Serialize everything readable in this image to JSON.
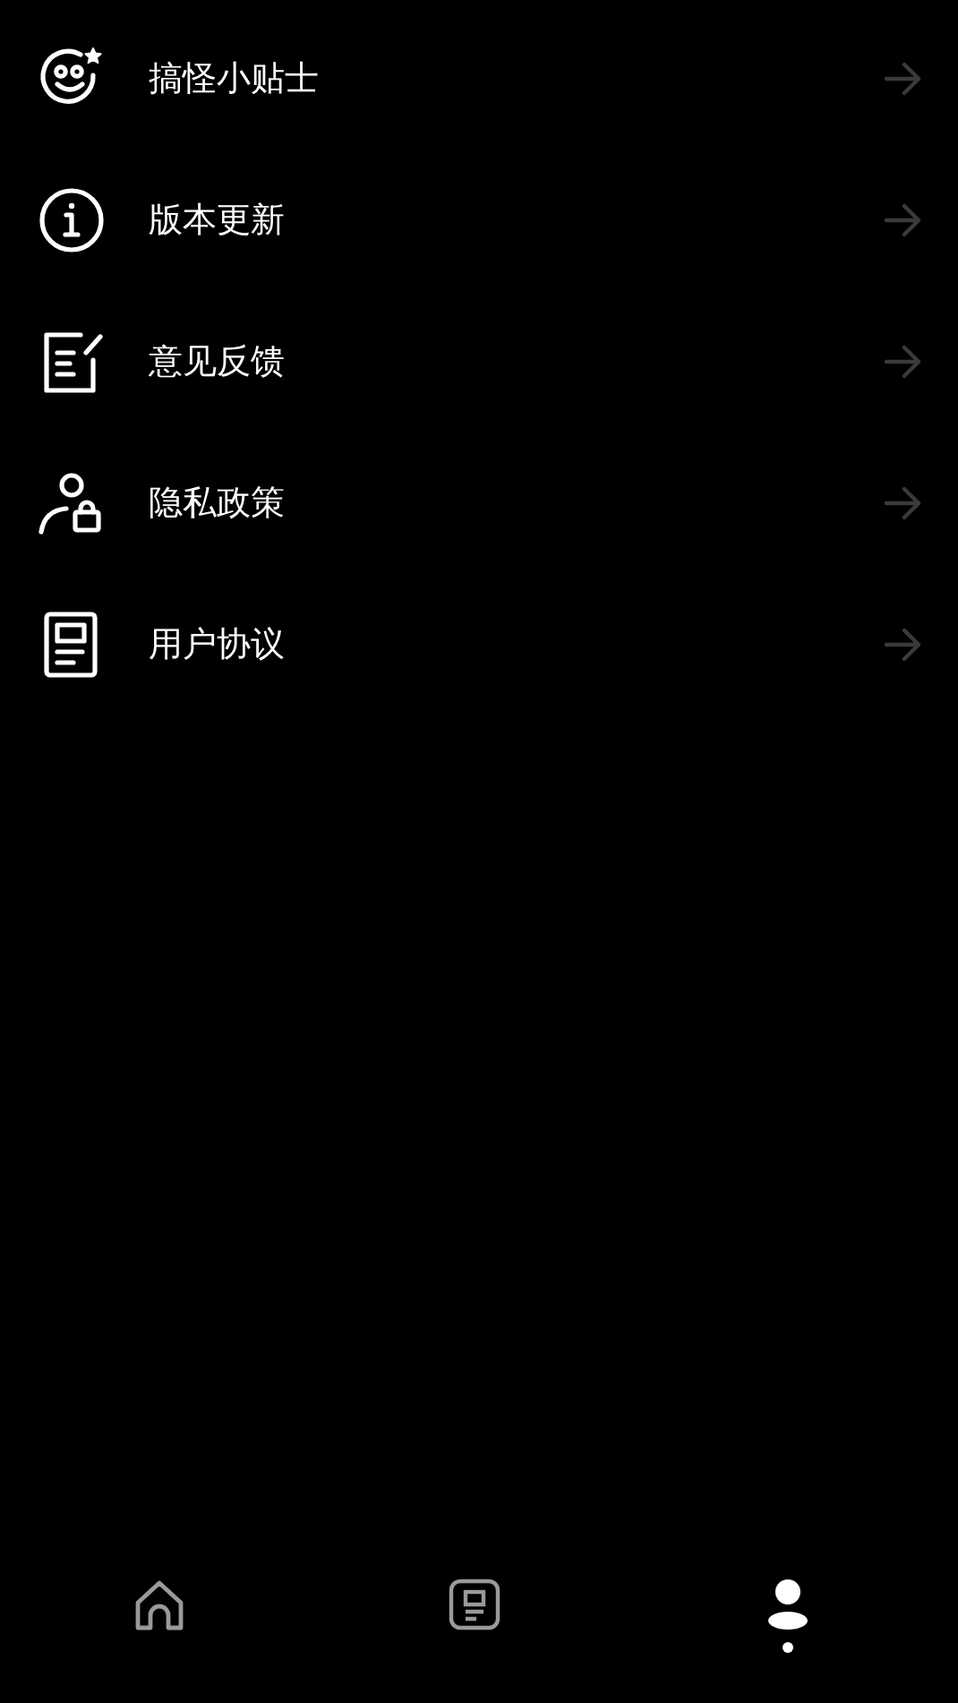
{
  "menu": [
    {
      "kind": "smile",
      "label": "搞怪小贴士"
    },
    {
      "kind": "info",
      "label": "版本更新"
    },
    {
      "kind": "edit",
      "label": "意见反馈"
    },
    {
      "kind": "privacy",
      "label": "隐私政策"
    },
    {
      "kind": "document",
      "label": "用户协议"
    }
  ],
  "tab_bar": [
    {
      "kind": "home",
      "selected": false
    },
    {
      "kind": "notes",
      "selected": false
    },
    {
      "kind": "profile",
      "selected": true
    }
  ]
}
